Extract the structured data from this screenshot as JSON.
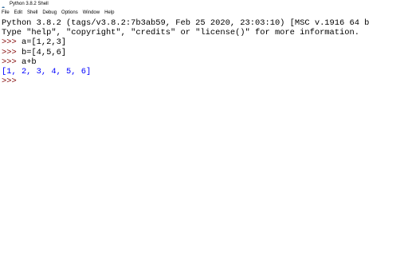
{
  "window": {
    "title": "Python 3.8.2 Shell",
    "app_icon": "python-icon"
  },
  "menubar": {
    "items": [
      "File",
      "Edit",
      "Shell",
      "Debug",
      "Options",
      "Window",
      "Help"
    ]
  },
  "shell": {
    "banner_line1": "Python 3.8.2 (tags/v3.8.2:7b3ab59, Feb 25 2020, 23:03:10) [MSC v.1916 64 b",
    "banner_line2": "Type \"help\", \"copyright\", \"credits\" or \"license()\" for more information.",
    "prompt": ">>> ",
    "cmd1": "a=[1,2,3]",
    "cmd2": "b=[4,5,6]",
    "cmd3": "a+b",
    "output1": "[1, 2, 3, 4, 5, 6]",
    "last_prompt": ">>> "
  },
  "colors": {
    "prompt": "#800000",
    "output": "#0000ff",
    "text": "#000000"
  }
}
